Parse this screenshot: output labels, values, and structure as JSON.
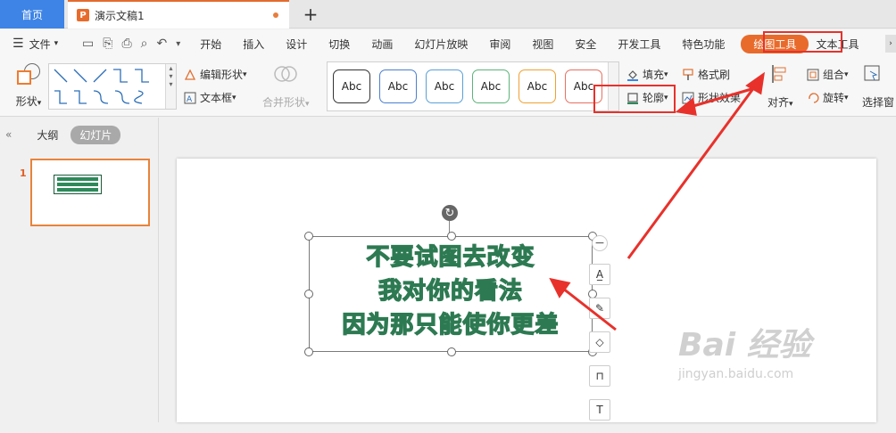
{
  "tabbar": {
    "home_label": "首页",
    "doc_icon": "P",
    "doc_title": "演示文稿1",
    "add_label": "+"
  },
  "menubar": {
    "file_label": "文件",
    "items": [
      "开始",
      "插入",
      "设计",
      "切换",
      "动画",
      "幻灯片放映",
      "审阅",
      "视图",
      "安全",
      "开发工具",
      "特色功能",
      "绘图工具",
      "文本工具"
    ],
    "active_item": "绘图工具"
  },
  "ribbon": {
    "shape_label": "形状",
    "edit_shape_label": "编辑形状",
    "textbox_label": "文本框",
    "merge_shape_label": "合并形状",
    "style_samples": [
      "Abc",
      "Abc",
      "Abc",
      "Abc",
      "Abc",
      "Abc"
    ],
    "style_colors": [
      "#333333",
      "#4a7fd0",
      "#5aa0d6",
      "#5cb37a",
      "#f0a030",
      "#e87060"
    ],
    "fill_label": "填充",
    "outline_label": "轮廓",
    "format_painter_label": "格式刷",
    "shape_effect_label": "形状效果",
    "align_label": "对齐",
    "group_label": "组合",
    "rotate_label": "旋转",
    "selection_pane_label": "选择窗"
  },
  "leftpanel": {
    "outline_tab": "大纲",
    "slides_tab": "幻灯片",
    "slide_number": "1"
  },
  "slide": {
    "text_lines": [
      "不要试图去改变",
      "我对你的看法",
      "因为那只能使你更差"
    ],
    "text_stroke_color": "#2d7a52"
  },
  "watermark": {
    "brand": "Bai 经验",
    "url": "jingyan.baidu.com"
  },
  "colors": {
    "accent": "#e86b2c",
    "home_tab": "#3d84e6",
    "annotation_red": "#e8312b"
  }
}
